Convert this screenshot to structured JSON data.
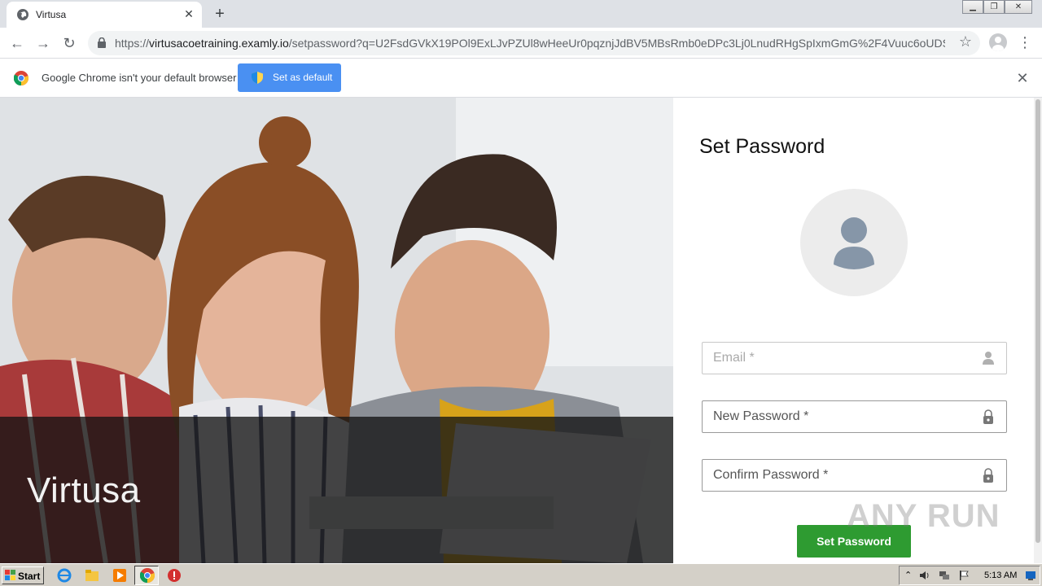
{
  "browser": {
    "tab_title": "Virtusa",
    "url_scheme": "https://",
    "url_host": "virtusacoetraining.examly.io",
    "url_path": "/setpassword?q=U2FsdGVkX19POl9ExLJvPZUl8wHeeUr0pqznjJdBV5MBsRmb0eDPc3Lj0LnudRHgSpIxmGmG%2F4Vuuc6oUDS0J..."
  },
  "infobar": {
    "message": "Google Chrome isn't your default browser",
    "button_label": "Set as default"
  },
  "hero": {
    "brand": "Virtusa"
  },
  "form": {
    "title": "Set Password",
    "email_placeholder": "Email *",
    "new_password_placeholder": "New Password *",
    "confirm_password_placeholder": "Confirm Password *",
    "submit_label": "Set Password"
  },
  "watermark": "ANY RUN",
  "taskbar": {
    "start_label": "Start",
    "clock": "5:13 AM"
  },
  "colors": {
    "submit_green": "#2e9b31",
    "infobar_button_blue": "#4a90f2",
    "overlay": "#141414"
  }
}
